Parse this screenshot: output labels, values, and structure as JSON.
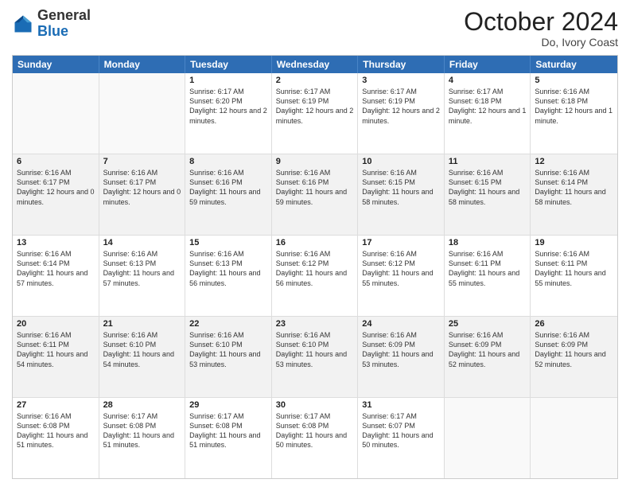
{
  "header": {
    "logo_general": "General",
    "logo_blue": "Blue",
    "month_title": "October 2024",
    "location": "Do, Ivory Coast"
  },
  "weekdays": [
    "Sunday",
    "Monday",
    "Tuesday",
    "Wednesday",
    "Thursday",
    "Friday",
    "Saturday"
  ],
  "rows": [
    [
      {
        "day": "",
        "info": "",
        "empty": true
      },
      {
        "day": "",
        "info": "",
        "empty": true
      },
      {
        "day": "1",
        "info": "Sunrise: 6:17 AM\nSunset: 6:20 PM\nDaylight: 12 hours and 2 minutes."
      },
      {
        "day": "2",
        "info": "Sunrise: 6:17 AM\nSunset: 6:19 PM\nDaylight: 12 hours and 2 minutes."
      },
      {
        "day": "3",
        "info": "Sunrise: 6:17 AM\nSunset: 6:19 PM\nDaylight: 12 hours and 2 minutes."
      },
      {
        "day": "4",
        "info": "Sunrise: 6:17 AM\nSunset: 6:18 PM\nDaylight: 12 hours and 1 minute."
      },
      {
        "day": "5",
        "info": "Sunrise: 6:16 AM\nSunset: 6:18 PM\nDaylight: 12 hours and 1 minute."
      }
    ],
    [
      {
        "day": "6",
        "info": "Sunrise: 6:16 AM\nSunset: 6:17 PM\nDaylight: 12 hours and 0 minutes."
      },
      {
        "day": "7",
        "info": "Sunrise: 6:16 AM\nSunset: 6:17 PM\nDaylight: 12 hours and 0 minutes."
      },
      {
        "day": "8",
        "info": "Sunrise: 6:16 AM\nSunset: 6:16 PM\nDaylight: 11 hours and 59 minutes."
      },
      {
        "day": "9",
        "info": "Sunrise: 6:16 AM\nSunset: 6:16 PM\nDaylight: 11 hours and 59 minutes."
      },
      {
        "day": "10",
        "info": "Sunrise: 6:16 AM\nSunset: 6:15 PM\nDaylight: 11 hours and 58 minutes."
      },
      {
        "day": "11",
        "info": "Sunrise: 6:16 AM\nSunset: 6:15 PM\nDaylight: 11 hours and 58 minutes."
      },
      {
        "day": "12",
        "info": "Sunrise: 6:16 AM\nSunset: 6:14 PM\nDaylight: 11 hours and 58 minutes."
      }
    ],
    [
      {
        "day": "13",
        "info": "Sunrise: 6:16 AM\nSunset: 6:14 PM\nDaylight: 11 hours and 57 minutes."
      },
      {
        "day": "14",
        "info": "Sunrise: 6:16 AM\nSunset: 6:13 PM\nDaylight: 11 hours and 57 minutes."
      },
      {
        "day": "15",
        "info": "Sunrise: 6:16 AM\nSunset: 6:13 PM\nDaylight: 11 hours and 56 minutes."
      },
      {
        "day": "16",
        "info": "Sunrise: 6:16 AM\nSunset: 6:12 PM\nDaylight: 11 hours and 56 minutes."
      },
      {
        "day": "17",
        "info": "Sunrise: 6:16 AM\nSunset: 6:12 PM\nDaylight: 11 hours and 55 minutes."
      },
      {
        "day": "18",
        "info": "Sunrise: 6:16 AM\nSunset: 6:11 PM\nDaylight: 11 hours and 55 minutes."
      },
      {
        "day": "19",
        "info": "Sunrise: 6:16 AM\nSunset: 6:11 PM\nDaylight: 11 hours and 55 minutes."
      }
    ],
    [
      {
        "day": "20",
        "info": "Sunrise: 6:16 AM\nSunset: 6:11 PM\nDaylight: 11 hours and 54 minutes."
      },
      {
        "day": "21",
        "info": "Sunrise: 6:16 AM\nSunset: 6:10 PM\nDaylight: 11 hours and 54 minutes."
      },
      {
        "day": "22",
        "info": "Sunrise: 6:16 AM\nSunset: 6:10 PM\nDaylight: 11 hours and 53 minutes."
      },
      {
        "day": "23",
        "info": "Sunrise: 6:16 AM\nSunset: 6:10 PM\nDaylight: 11 hours and 53 minutes."
      },
      {
        "day": "24",
        "info": "Sunrise: 6:16 AM\nSunset: 6:09 PM\nDaylight: 11 hours and 53 minutes."
      },
      {
        "day": "25",
        "info": "Sunrise: 6:16 AM\nSunset: 6:09 PM\nDaylight: 11 hours and 52 minutes."
      },
      {
        "day": "26",
        "info": "Sunrise: 6:16 AM\nSunset: 6:09 PM\nDaylight: 11 hours and 52 minutes."
      }
    ],
    [
      {
        "day": "27",
        "info": "Sunrise: 6:16 AM\nSunset: 6:08 PM\nDaylight: 11 hours and 51 minutes."
      },
      {
        "day": "28",
        "info": "Sunrise: 6:17 AM\nSunset: 6:08 PM\nDaylight: 11 hours and 51 minutes."
      },
      {
        "day": "29",
        "info": "Sunrise: 6:17 AM\nSunset: 6:08 PM\nDaylight: 11 hours and 51 minutes."
      },
      {
        "day": "30",
        "info": "Sunrise: 6:17 AM\nSunset: 6:08 PM\nDaylight: 11 hours and 50 minutes."
      },
      {
        "day": "31",
        "info": "Sunrise: 6:17 AM\nSunset: 6:07 PM\nDaylight: 11 hours and 50 minutes."
      },
      {
        "day": "",
        "info": "",
        "empty": true
      },
      {
        "day": "",
        "info": "",
        "empty": true
      }
    ]
  ]
}
